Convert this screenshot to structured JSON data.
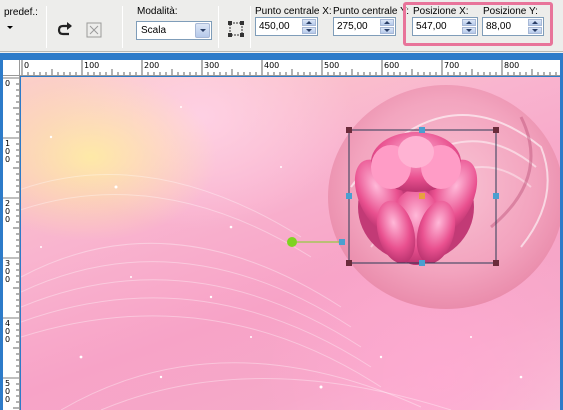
{
  "toolbar": {
    "preset_label": "predef.:",
    "mode_label": "Modalità:",
    "mode_value": "Scala",
    "center_x_label": "Punto centrale X:",
    "center_x_value": "450,00",
    "center_y_label": "Punto centrale Y:",
    "center_y_value": "275,00",
    "pos_x_label": "Posizione X:",
    "pos_x_value": "547,00",
    "pos_y_label": "Posizione Y:",
    "pos_y_value": "88,00",
    "highlight_color": "#e8749a"
  },
  "icons": {
    "preset": "preset-dropdown-icon",
    "reset": "reset-rotate-icon",
    "transform": "free-transform-icon",
    "apply": "apply-deform-icon"
  },
  "ruler_top": [
    "0",
    "100",
    "200",
    "300",
    "400",
    "500",
    "600",
    "700",
    "800"
  ],
  "ruler_left": [
    "0",
    "100",
    "200",
    "300",
    "400",
    "500"
  ],
  "canvas": {
    "background_colors": [
      "#fbd0c8",
      "#f9b4cf",
      "#f7a3c7"
    ],
    "selection_handle_color": "#4a7fa8",
    "pivot_color": "#7ed321"
  }
}
